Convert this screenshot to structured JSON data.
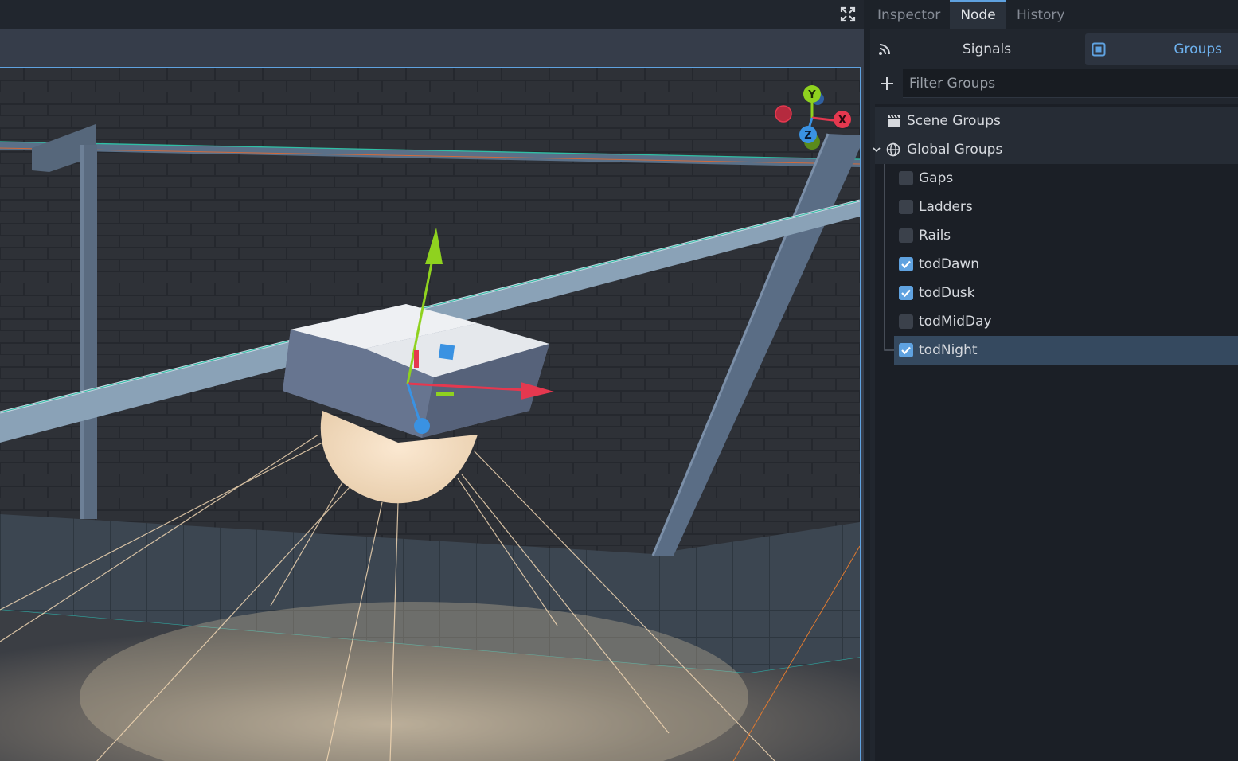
{
  "dock": {
    "tabs": [
      {
        "label": "Inspector"
      },
      {
        "label": "Node"
      },
      {
        "label": "History"
      }
    ],
    "active_tab": "Node",
    "subtabs": {
      "signals": "Signals",
      "groups": "Groups"
    },
    "filter": {
      "placeholder": "Filter Groups",
      "value": ""
    },
    "scene_groups_label": "Scene Groups",
    "global_groups_label": "Global Groups",
    "groups": [
      {
        "name": "Gaps",
        "checked": false
      },
      {
        "name": "Ladders",
        "checked": false
      },
      {
        "name": "Rails",
        "checked": false
      },
      {
        "name": "todDawn",
        "checked": true
      },
      {
        "name": "todDusk",
        "checked": true
      },
      {
        "name": "todMidDay",
        "checked": false
      },
      {
        "name": "todNight",
        "checked": true,
        "selected": true
      }
    ]
  },
  "viewport": {
    "gizmo_axes": {
      "y": "Y",
      "x": "X",
      "z": "Z"
    }
  },
  "colors": {
    "accent": "#5fa2e0",
    "axis_x": "#e5384f",
    "axis_y": "#8fd21f",
    "axis_z": "#3a92e2"
  }
}
